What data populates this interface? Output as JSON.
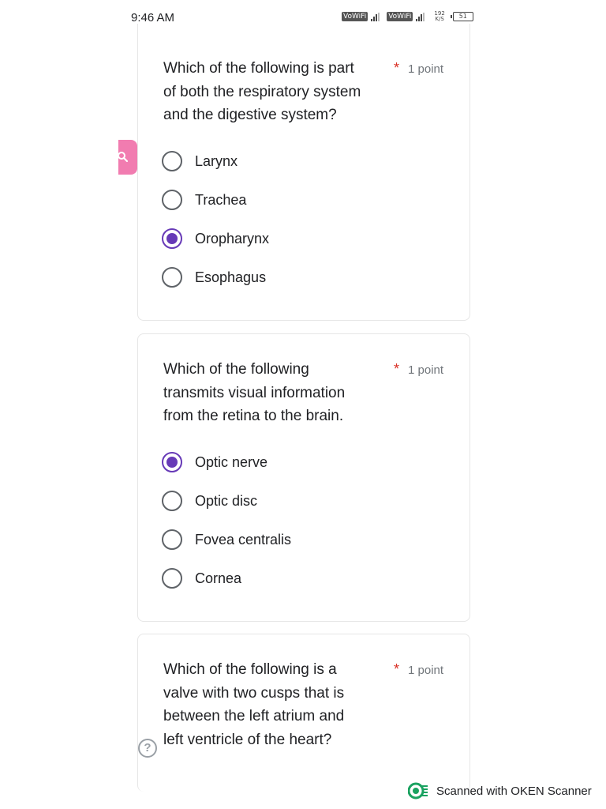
{
  "status_bar": {
    "time": "9:46 AM",
    "network_1": "VoWiFi",
    "network_2": "VoWiFi",
    "speed_value": "192",
    "speed_unit": "K/S",
    "battery": "51"
  },
  "questions": [
    {
      "text": "Which of the following is part of both the respiratory system and the digestive system?",
      "lines": [
        "Which of the following is part",
        "of both the respiratory system",
        "and the digestive system?"
      ],
      "required_mark": "*",
      "points": "1 point",
      "options": [
        {
          "label": "Larynx",
          "selected": false
        },
        {
          "label": "Trachea",
          "selected": false
        },
        {
          "label": "Oropharynx",
          "selected": true
        },
        {
          "label": "Esophagus",
          "selected": false
        }
      ]
    },
    {
      "text": "Which of the following transmits visual information from the retina to the brain.",
      "lines": [
        "Which of the following",
        "transmits visual information",
        "from the retina to the brain."
      ],
      "required_mark": "*",
      "points": "1 point",
      "options": [
        {
          "label": "Optic nerve",
          "selected": true
        },
        {
          "label": "Optic disc",
          "selected": false
        },
        {
          "label": "Fovea centralis",
          "selected": false
        },
        {
          "label": "Cornea",
          "selected": false
        }
      ]
    },
    {
      "text": "Which of the following is a valve with two cusps that is between the left atrium and left ventricle of the heart?",
      "lines": [
        "Which of the following is a",
        "valve with two cusps that is",
        "between the left atrium and",
        "left ventricle of the heart?"
      ],
      "required_mark": "*",
      "points": "1 point"
    }
  ],
  "help_icon_glyph": "?",
  "watermark": {
    "text": "Scanned with OKEN Scanner"
  },
  "colors": {
    "accent": "#673ab7",
    "required": "#d93025",
    "search_tab": "#f17cb0",
    "watermark_logo": "#1aa260"
  },
  "icons": [
    "search-icon",
    "help-icon",
    "oken-scanner-logo-icon"
  ]
}
